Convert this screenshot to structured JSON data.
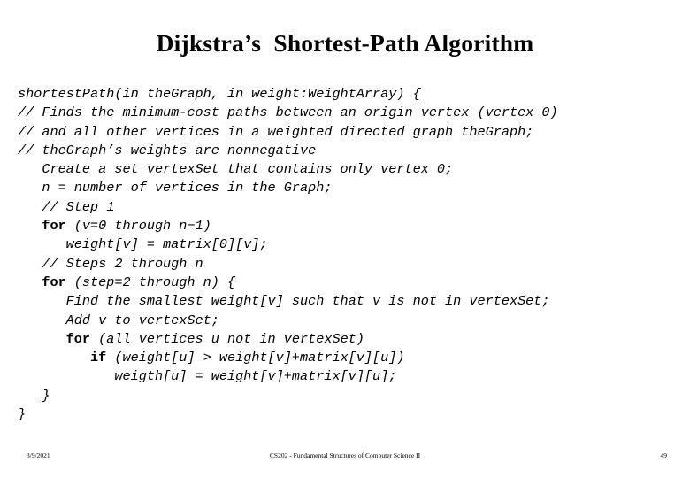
{
  "slide": {
    "title": "Dijkstra’s  Shortest-Path Algorithm",
    "background_color": "#ffffff",
    "text_color": "#000000"
  },
  "code": {
    "lines": [
      {
        "indent": 0,
        "keyword": "",
        "text": "shortestPath(in theGraph, in weight:WeightArray) {"
      },
      {
        "indent": 0,
        "keyword": "",
        "text": "// Finds the minimum-cost paths between an origin vertex (vertex 0)"
      },
      {
        "indent": 0,
        "keyword": "",
        "text": "// and all other vertices in a weighted directed graph theGraph;"
      },
      {
        "indent": 0,
        "keyword": "",
        "text": "// theGraph’s weights are nonnegative"
      },
      {
        "indent": 3,
        "keyword": "",
        "text": "Create a set vertexSet that contains only vertex 0;"
      },
      {
        "indent": 3,
        "keyword": "",
        "text": "n = number of vertices in the Graph;"
      },
      {
        "indent": 3,
        "keyword": "",
        "text": "// Step 1"
      },
      {
        "indent": 3,
        "keyword": "for",
        "text": " (v=0 through n−1)"
      },
      {
        "indent": 6,
        "keyword": "",
        "text": "weight[v] = matrix[0][v];"
      },
      {
        "indent": 3,
        "keyword": "",
        "text": "// Steps 2 through n"
      },
      {
        "indent": 3,
        "keyword": "for",
        "text": " (step=2 through n) {"
      },
      {
        "indent": 6,
        "keyword": "",
        "text": "Find the smallest weight[v] such that v is not in vertexSet;"
      },
      {
        "indent": 6,
        "keyword": "",
        "text": "Add v to vertexSet;"
      },
      {
        "indent": 6,
        "keyword": "for",
        "text": " (all vertices u not in vertexSet)"
      },
      {
        "indent": 9,
        "keyword": "if",
        "text": " (weight[u] > weight[v]+matrix[v][u])"
      },
      {
        "indent": 12,
        "keyword": "",
        "text": "weigth[u] = weight[v]+matrix[v][u];"
      },
      {
        "indent": 3,
        "keyword": "",
        "text": "}"
      },
      {
        "indent": 0,
        "keyword": "",
        "text": "}"
      }
    ]
  },
  "footer": {
    "date": "3/9/2021",
    "course": "CS202 - Fundamental Structures of Computer Science II",
    "page_number": "49"
  }
}
